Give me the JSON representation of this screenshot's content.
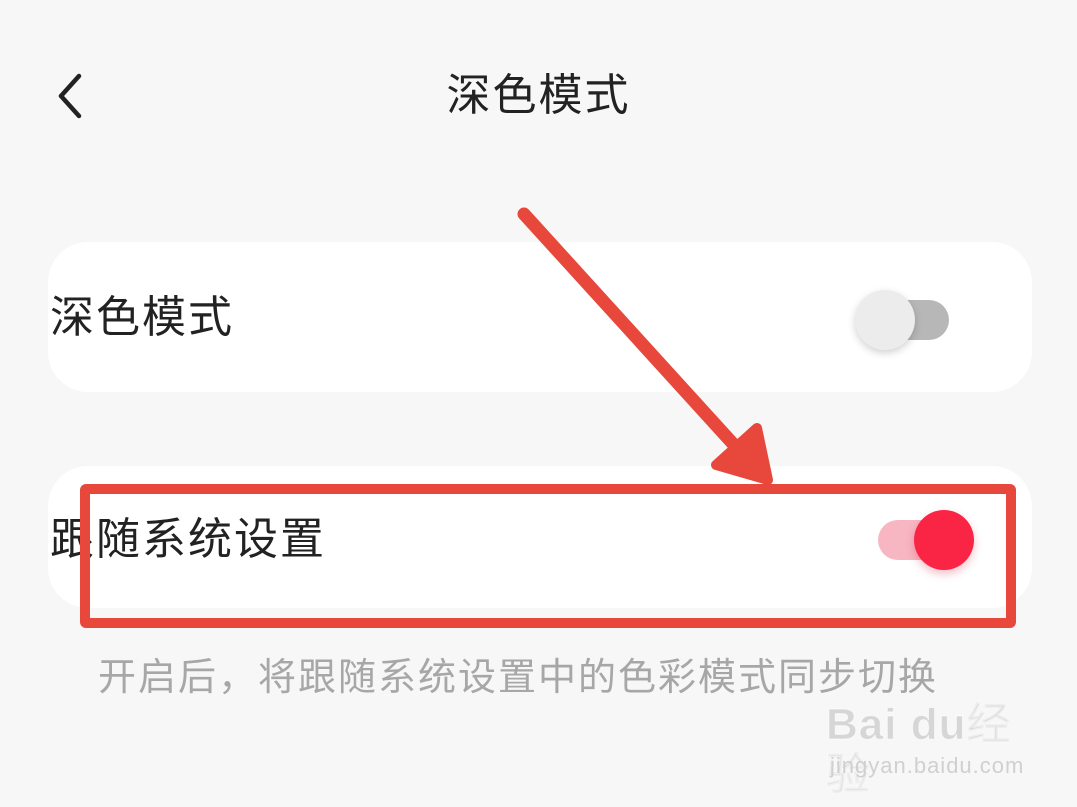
{
  "header": {
    "title": "深色模式",
    "back_icon": "chevron-left-icon"
  },
  "settings": {
    "dark_mode": {
      "label": "深色模式",
      "enabled": false
    },
    "follow_system": {
      "label": "跟随系统设置",
      "enabled": true
    }
  },
  "description": "开启后，将跟随系统设置中的色彩模式同步切换",
  "annotation": {
    "highlight_color": "#e8473c",
    "arrow_color": "#e8473c"
  },
  "colors": {
    "background": "#f7f7f7",
    "card": "#ffffff",
    "toggle_on_knob": "#fa2545",
    "toggle_on_track": "#f8b6c2",
    "toggle_off_knob": "#ececec",
    "toggle_off_track": "#b7b7b7"
  },
  "watermark": {
    "line1": "Bai du经验",
    "line2": "jingyan.baidu.com"
  }
}
